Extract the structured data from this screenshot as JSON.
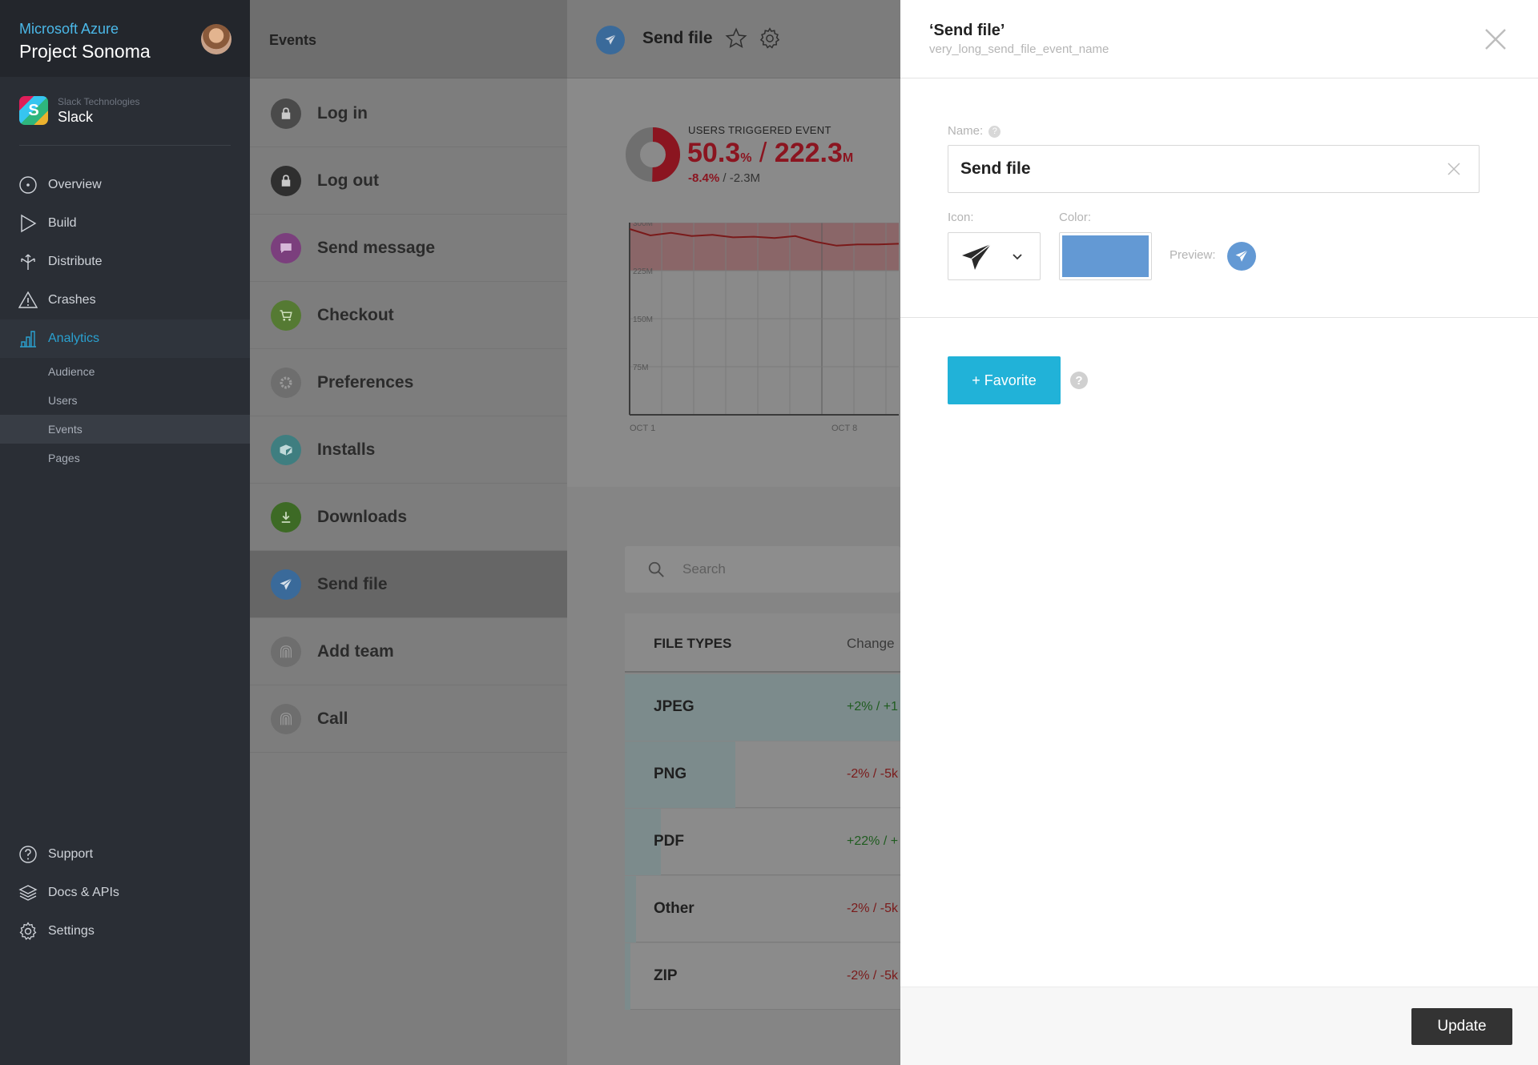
{
  "sidebar": {
    "brand": "Microsoft Azure",
    "project": "Project Sonoma",
    "app_company": "Slack Technologies",
    "app_name": "Slack",
    "nav": [
      {
        "label": "Overview",
        "icon": "overview-icon"
      },
      {
        "label": "Build",
        "icon": "build-icon"
      },
      {
        "label": "Distribute",
        "icon": "distribute-icon"
      },
      {
        "label": "Crashes",
        "icon": "warning-icon"
      },
      {
        "label": "Analytics",
        "icon": "analytics-icon",
        "active": true
      }
    ],
    "analytics_sub": [
      {
        "label": "Audience"
      },
      {
        "label": "Users"
      },
      {
        "label": "Events",
        "active": true
      },
      {
        "label": "Pages"
      }
    ],
    "bottom_nav": [
      {
        "label": "Support",
        "icon": "help-icon"
      },
      {
        "label": "Docs & APIs",
        "icon": "layers-icon"
      },
      {
        "label": "Settings",
        "icon": "gear-icon"
      }
    ]
  },
  "events_list": {
    "title": "Events",
    "items": [
      {
        "label": "Log in",
        "icon": "lock-icon",
        "color": "#4a4a4a"
      },
      {
        "label": "Log out",
        "icon": "lock-icon",
        "color": "#2f2f2f"
      },
      {
        "label": "Send message",
        "icon": "message-icon",
        "color": "#7b3f7d"
      },
      {
        "label": "Checkout",
        "icon": "cart-icon",
        "color": "#557a33"
      },
      {
        "label": "Preferences",
        "icon": "gear-icon",
        "color": "#6e6e6e"
      },
      {
        "label": "Installs",
        "icon": "box-icon",
        "color": "#3f7e80"
      },
      {
        "label": "Downloads",
        "icon": "download-icon",
        "color": "#3d6a25"
      },
      {
        "label": "Send file",
        "icon": "paper-plane-icon",
        "color": "#3a6a9a",
        "active": true
      },
      {
        "label": "Add team",
        "icon": "fingerprint-icon",
        "color": "#6e6e6e"
      },
      {
        "label": "Call",
        "icon": "fingerprint-icon",
        "color": "#6e6e6e"
      }
    ]
  },
  "main": {
    "title": "Send file",
    "kpi": {
      "label": "USERS TRIGGERED EVENT",
      "percent": "50.3",
      "percent_unit": "%",
      "separator": "/",
      "count": "222.3",
      "count_unit": "M",
      "change_pct": "-8.4%",
      "change_sep": "/",
      "change_abs": "-2.3M",
      "donut_fraction": 0.503
    },
    "search": {
      "placeholder": "Search"
    },
    "table": {
      "columns": [
        "FILE TYPES",
        "Change"
      ],
      "rows": [
        {
          "name": "JPEG",
          "change": "+2% / +1",
          "positive": true,
          "share": 1.0
        },
        {
          "name": "PNG",
          "change": "-2% / -5k",
          "positive": false,
          "share": 0.4
        },
        {
          "name": "PDF",
          "change": "+22% / +",
          "positive": true,
          "share": 0.13
        },
        {
          "name": "Other",
          "change": "-2% / -5k",
          "positive": false,
          "share": 0.04
        },
        {
          "name": "ZIP",
          "change": "-2% / -5k",
          "positive": false,
          "share": 0.02
        }
      ]
    }
  },
  "chart_data": {
    "type": "line",
    "x_ticks": [
      "OCT 1",
      "OCT 8"
    ],
    "y_ticks": [
      "300M",
      "225M",
      "150M",
      "75M"
    ],
    "ylim": [
      0,
      300
    ],
    "band": [
      225,
      300
    ],
    "series": [
      {
        "values": [
          290,
          280,
          284,
          279,
          281,
          277,
          278,
          276,
          279,
          270,
          264,
          266,
          266,
          267
        ]
      }
    ]
  },
  "panel": {
    "title": "‘Send file’",
    "event_key": "very_long_send_file_event_name",
    "name_label": "Name:",
    "name_value": "Send file",
    "icon_label": "Icon:",
    "color_label": "Color:",
    "color_value": "#6399d4",
    "preview_label": "Preview:",
    "favorite_label": "+ Favorite",
    "help_glyph": "?",
    "update_label": "Update"
  }
}
